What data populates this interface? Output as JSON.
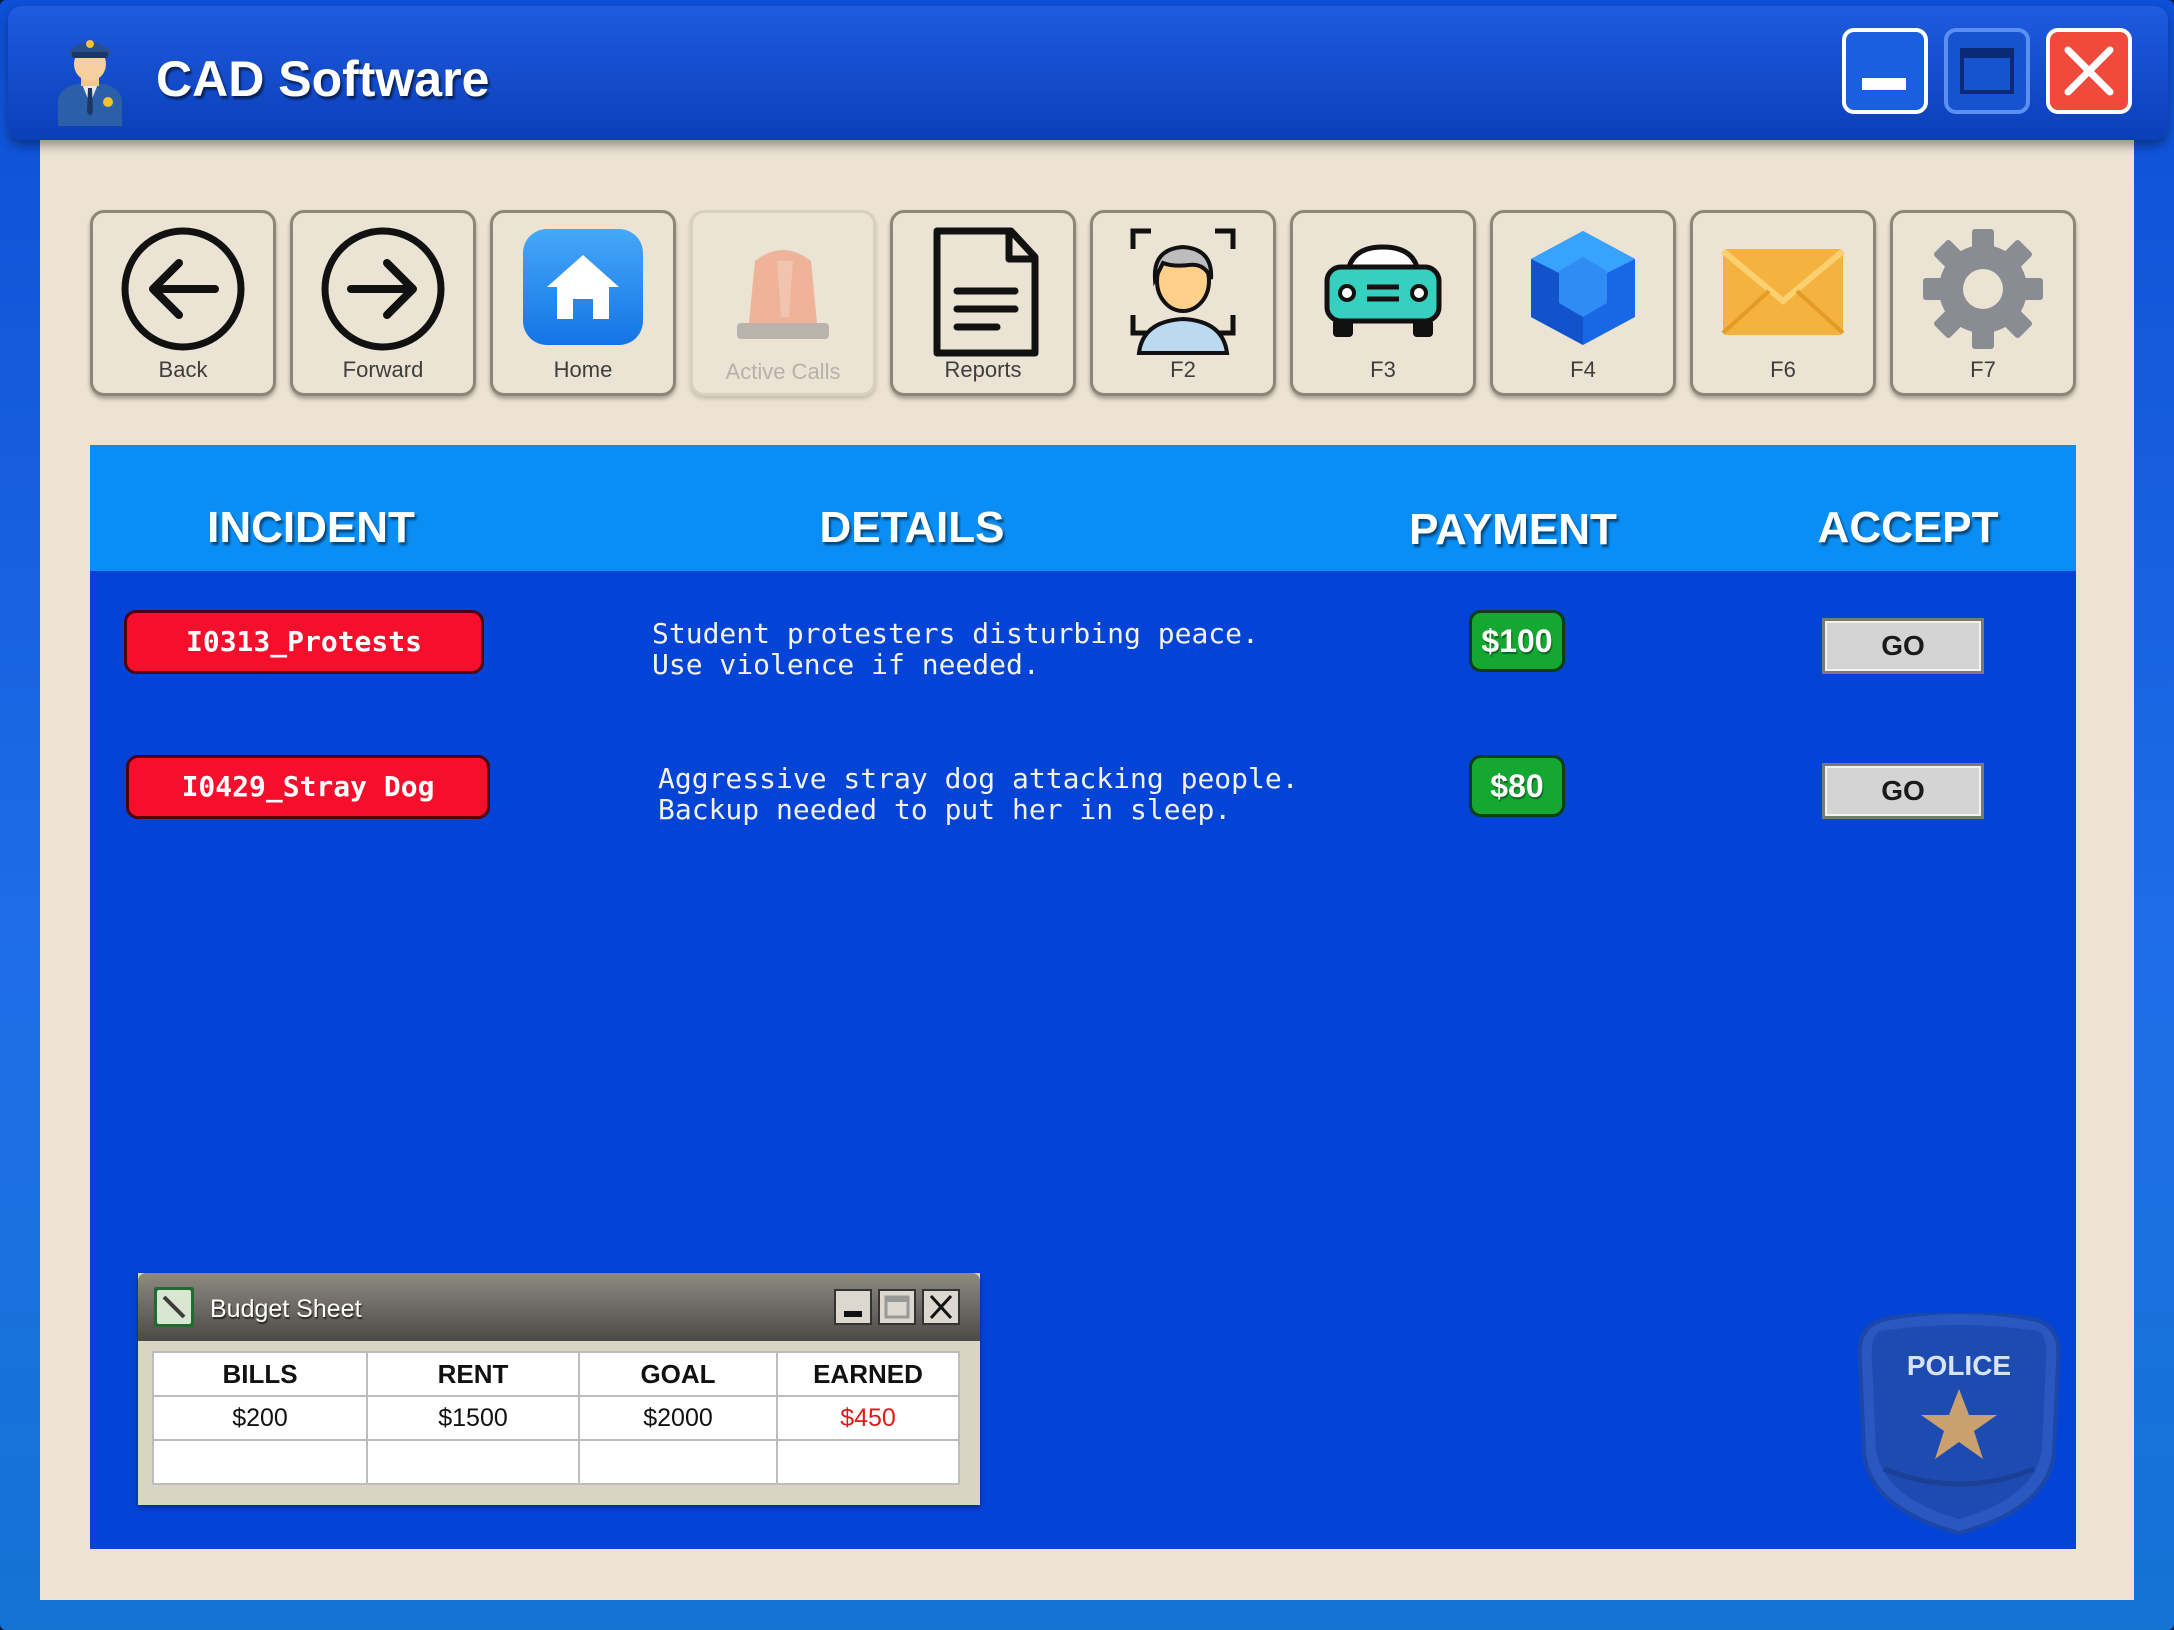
{
  "window": {
    "title": "CAD Software",
    "icon": "police-officer-icon"
  },
  "window_controls": [
    "minimize",
    "maximize",
    "close"
  ],
  "toolbar": [
    {
      "label": "Back",
      "icon": "arrow-left-icon",
      "enabled": true
    },
    {
      "label": "Forward",
      "icon": "arrow-right-icon",
      "enabled": true
    },
    {
      "label": "Home",
      "icon": "home-icon",
      "enabled": true
    },
    {
      "label": "Active Calls",
      "icon": "siren-icon",
      "enabled": false
    },
    {
      "label": "Reports",
      "icon": "document-icon",
      "enabled": true
    },
    {
      "label": "F2",
      "icon": "face-scan-icon",
      "enabled": true
    },
    {
      "label": "F3",
      "icon": "car-icon",
      "enabled": true
    },
    {
      "label": "F4",
      "icon": "gem-icon",
      "enabled": true
    },
    {
      "label": "F6",
      "icon": "mail-icon",
      "enabled": true
    },
    {
      "label": "F7",
      "icon": "gear-icon",
      "enabled": true
    }
  ],
  "table": {
    "headers": {
      "incident": "INCIDENT",
      "details": "DETAILS",
      "payment": "PAYMENT",
      "accept": "ACCEPT"
    },
    "rows": [
      {
        "incident": "I0313_Protests",
        "details": "Student protesters disturbing peace.\nUse violence if needed.",
        "payment": "$100",
        "accept": "GO"
      },
      {
        "incident": "I0429_Stray Dog",
        "details": "Aggressive stray dog attacking people.\nBackup needed to put her in sleep.",
        "payment": "$80",
        "accept": "GO"
      }
    ]
  },
  "budget_sheet": {
    "title": "Budget Sheet",
    "headers": [
      "BILLS",
      "RENT",
      "GOAL",
      "EARNED"
    ],
    "values": [
      "$200",
      "$1500",
      "$2000",
      "$450"
    ],
    "earned_color": "#e01b1b"
  },
  "badge": {
    "text": "POLICE"
  },
  "colors": {
    "titlebar": "#0a3fb8",
    "main_panel": "#0343d6",
    "header_bar": "#0a8ef5",
    "incident_button": "#f50f2c",
    "payment_badge": "#14a832"
  }
}
